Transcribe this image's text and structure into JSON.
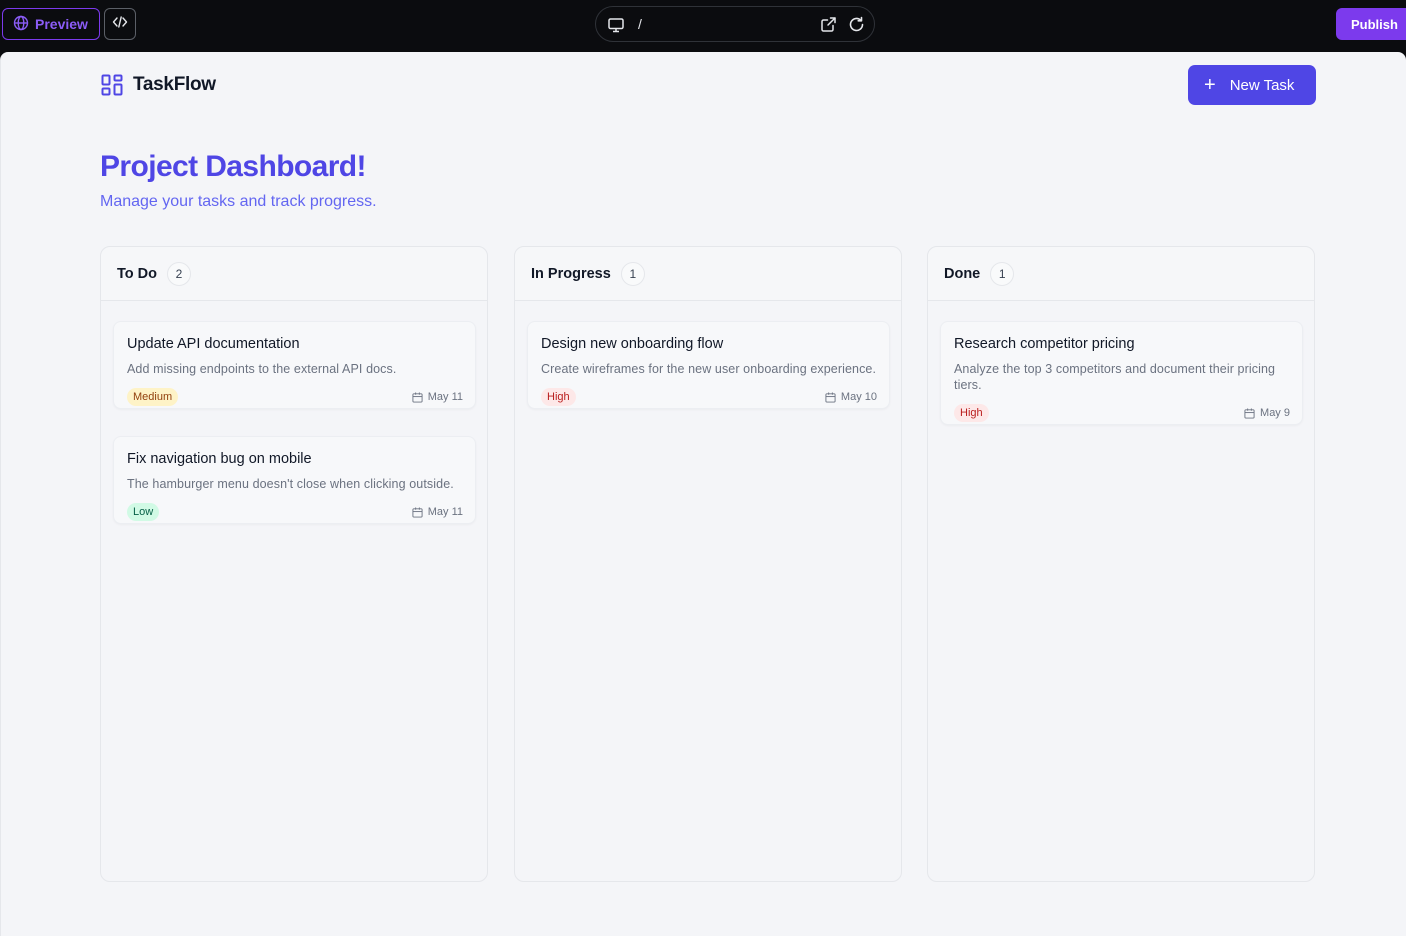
{
  "editor": {
    "preview_label": "Preview",
    "url_path": "/",
    "publish_label": "Publish"
  },
  "app": {
    "brand": "TaskFlow",
    "new_task_label": "New Task",
    "title": "Project Dashboard!",
    "subtitle": "Manage your tasks and track progress."
  },
  "columns": [
    {
      "title": "To Do",
      "count": "2",
      "cards": [
        {
          "title": "Update API documentation",
          "description": "Add missing endpoints to the external API docs.",
          "priority": "Medium",
          "due": "May 11"
        },
        {
          "title": "Fix navigation bug on mobile",
          "description": "The hamburger menu doesn't close when clicking outside.",
          "priority": "Low",
          "due": "May 11"
        }
      ]
    },
    {
      "title": "In Progress",
      "count": "1",
      "cards": [
        {
          "title": "Design new onboarding flow",
          "description": "Create wireframes for the new user onboarding experience.",
          "priority": "High",
          "due": "May 10"
        }
      ]
    },
    {
      "title": "Done",
      "count": "1",
      "cards": [
        {
          "title": "Research competitor pricing",
          "description": "Analyze the top 3 competitors and document their pricing tiers.",
          "priority": "High",
          "due": "May 9"
        }
      ]
    }
  ],
  "colors": {
    "accent": "#4f46e5",
    "publish": "#7c3aed",
    "priority_medium": "#fef3c7",
    "priority_low": "#d1fae5",
    "priority_high": "#fde8e8"
  }
}
